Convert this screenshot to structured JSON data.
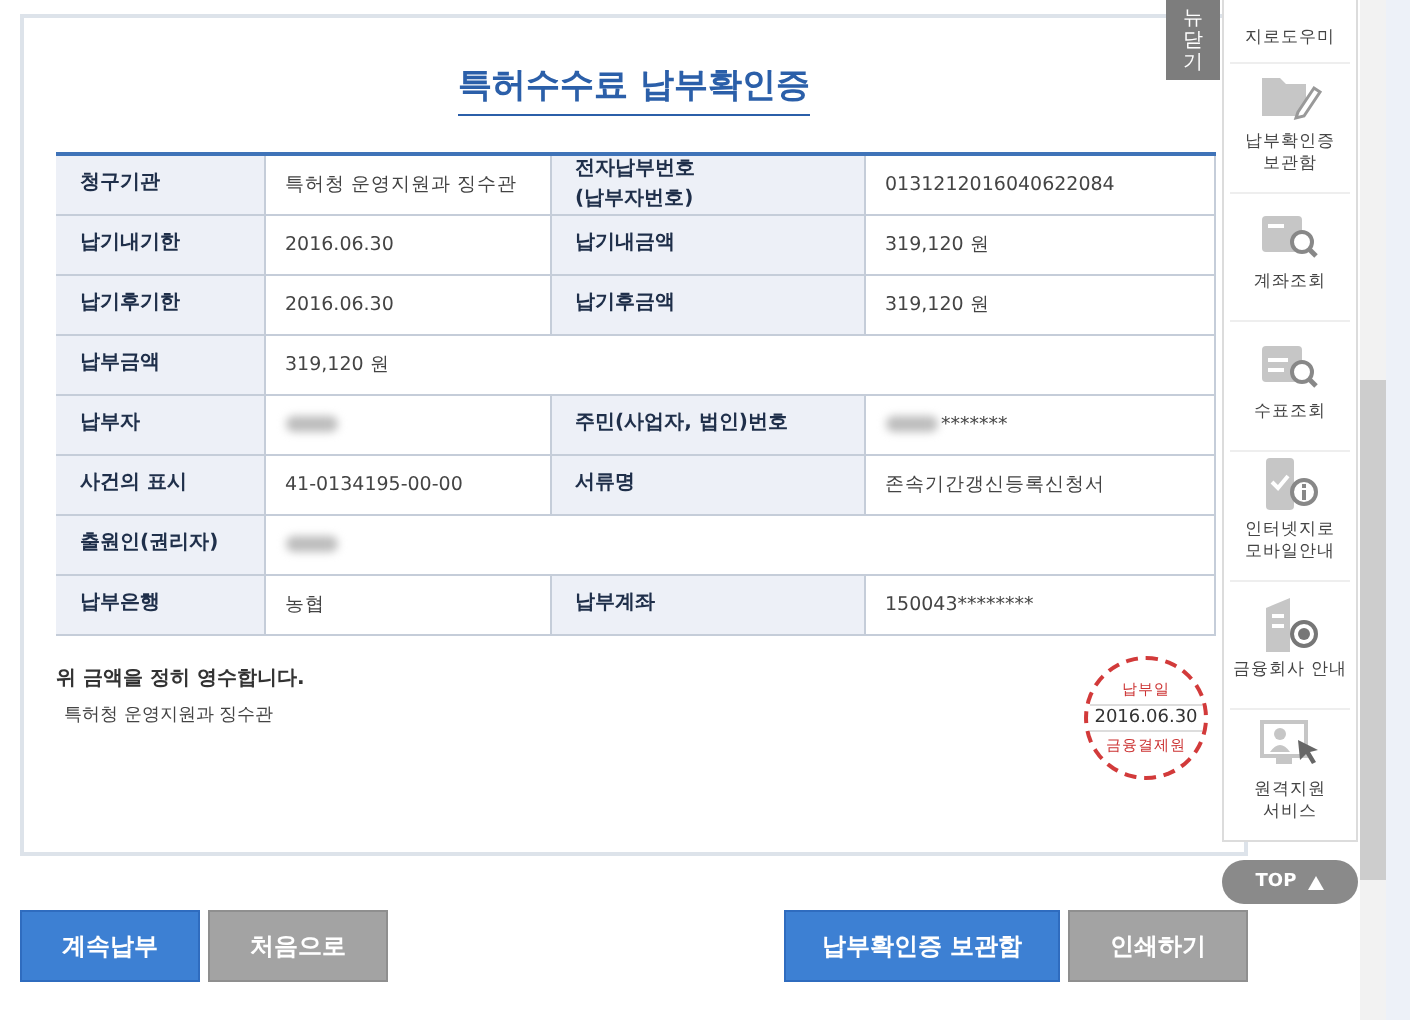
{
  "close_tab": {
    "label": "뉴닫기"
  },
  "title": "특허수수료 납부확인증",
  "rows": [
    {
      "cells": [
        {
          "kind": "label",
          "text": "청구기관"
        },
        {
          "kind": "value",
          "text": "특허청 운영지원과 징수관"
        },
        {
          "kind": "label",
          "text": "전자납부번호\n(납부자번호)"
        },
        {
          "kind": "value",
          "text": "0131212016040622084"
        }
      ]
    },
    {
      "cells": [
        {
          "kind": "label",
          "text": "납기내기한"
        },
        {
          "kind": "value",
          "text": "2016.06.30"
        },
        {
          "kind": "label",
          "text": "납기내금액"
        },
        {
          "kind": "value",
          "text": "319,120 원"
        }
      ]
    },
    {
      "cells": [
        {
          "kind": "label",
          "text": "납기후기한"
        },
        {
          "kind": "value",
          "text": "2016.06.30"
        },
        {
          "kind": "label",
          "text": "납기후금액"
        },
        {
          "kind": "value",
          "text": "319,120 원"
        }
      ]
    },
    {
      "cells": [
        {
          "kind": "label",
          "text": "납부금액"
        },
        {
          "kind": "value",
          "text": "319,120 원"
        }
      ]
    },
    {
      "cells": [
        {
          "kind": "label",
          "text": "납부자"
        },
        {
          "kind": "redacted"
        },
        {
          "kind": "label",
          "text": "주민(사업자, 법인)번호"
        },
        {
          "kind": "redacted",
          "text": "*******"
        }
      ]
    },
    {
      "cells": [
        {
          "kind": "label",
          "text": "사건의 표시"
        },
        {
          "kind": "value",
          "text": "41-0134195-00-00"
        },
        {
          "kind": "label",
          "text": "서류명"
        },
        {
          "kind": "value",
          "text": "존속기간갱신등록신청서"
        }
      ]
    },
    {
      "cells": [
        {
          "kind": "label",
          "text": "출원인(권리자)"
        },
        {
          "kind": "redacted"
        }
      ]
    },
    {
      "cells": [
        {
          "kind": "label",
          "text": "납부은행"
        },
        {
          "kind": "value",
          "text": "농협"
        },
        {
          "kind": "label",
          "text": "납부계좌"
        },
        {
          "kind": "value",
          "text": "150043********"
        }
      ]
    }
  ],
  "receipt_note": "위 금액을 정히 영수합니다.",
  "issuer": "특허청 운영지원과 징수관",
  "stamp": {
    "top": "납부일",
    "date": "2016.06.30",
    "bottom": "금융결제원"
  },
  "buttons": [
    {
      "label": "계속납부",
      "kind": "primary"
    },
    {
      "label": "처음으로",
      "kind": "secondary"
    },
    {
      "label": "납부확인증 보관함",
      "kind": "primary"
    },
    {
      "label": "인쇄하기",
      "kind": "secondary"
    }
  ],
  "quick_menu": [
    {
      "label": "지로도우미",
      "kind": "cut"
    },
    {
      "label": "납부확인증\n보관함",
      "kind": "folder"
    },
    {
      "label": "계좌조회",
      "kind": "card"
    },
    {
      "label": "수표조회",
      "kind": "check"
    },
    {
      "label": "인터넷지로\n모바일안내",
      "kind": "phone"
    },
    {
      "label": "금융회사 안내",
      "kind": "building"
    },
    {
      "label": "원격지원\n서비스",
      "kind": "monitor"
    }
  ],
  "top_button": {
    "label": "TOP"
  }
}
